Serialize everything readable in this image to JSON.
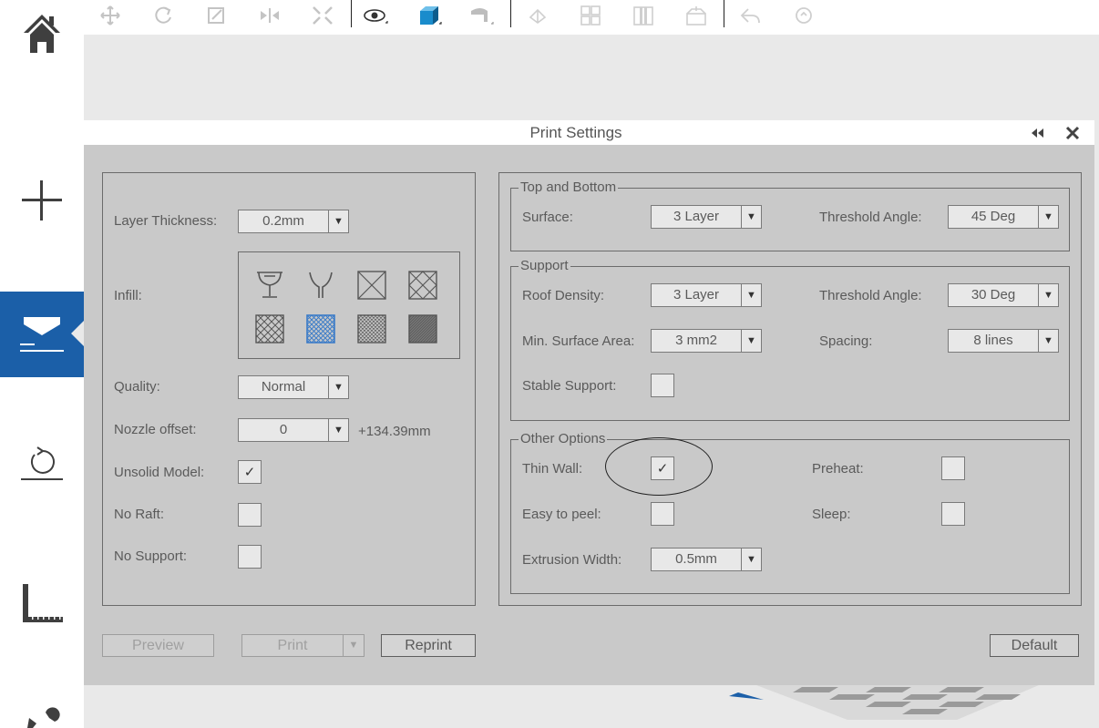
{
  "nav": {
    "items": [
      {
        "name": "home-icon"
      },
      {
        "name": "add-icon"
      },
      {
        "name": "print-settings-icon",
        "active": true
      },
      {
        "name": "rotate-reset-icon"
      },
      {
        "name": "measure-ruler-icon"
      },
      {
        "name": "tools-icon"
      }
    ]
  },
  "toolbar": {
    "tools": [
      "move-icon",
      "rotate-icon",
      "scale-icon",
      "mirror-icon",
      "auto-arrange-icon",
      "view-icon",
      "cube-view-icon",
      "support-icon",
      "repair-icon",
      "layout-grid-icon",
      "split-icon",
      "packaging-icon",
      "undo-icon",
      "redo-icon"
    ]
  },
  "dialog": {
    "title": "Print Settings",
    "left": {
      "layer_thickness": {
        "label": "Layer Thickness:",
        "value": "0.2mm"
      },
      "infill": {
        "label": "Infill:",
        "patterns": [
          "hollow-cup-icon",
          "shell-cup-icon",
          "sparse-cross-icon",
          "diamond-cross-icon",
          "lattice-light-icon",
          "lattice-selected-icon",
          "lattice-medium-icon",
          "solid-icon"
        ],
        "selected_index": 5
      },
      "quality": {
        "label": "Quality:",
        "value": "Normal"
      },
      "nozzle_offset": {
        "label": "Nozzle offset:",
        "value": "0",
        "suffix": "+134.39mm"
      },
      "unsolid_model": {
        "label": "Unsolid Model:",
        "checked": true
      },
      "no_raft": {
        "label": "No Raft:",
        "checked": false
      },
      "no_support": {
        "label": "No Support:",
        "checked": false
      }
    },
    "top_bottom": {
      "legend": "Top and Bottom",
      "surface": {
        "label": "Surface:",
        "value": "3 Layer"
      },
      "threshold": {
        "label": "Threshold Angle:",
        "value": "45 Deg"
      }
    },
    "support": {
      "legend": "Support",
      "roof_density": {
        "label": "Roof Density:",
        "value": "3 Layer"
      },
      "threshold": {
        "label": "Threshold Angle:",
        "value": "30 Deg"
      },
      "min_surface": {
        "label": "Min. Surface Area:",
        "value": "3 mm2"
      },
      "spacing": {
        "label": "Spacing:",
        "value": "8 lines"
      },
      "stable_support": {
        "label": "Stable Support:",
        "checked": false
      }
    },
    "other": {
      "legend": "Other Options",
      "thin_wall": {
        "label": "Thin Wall:",
        "checked": true
      },
      "preheat": {
        "label": "Preheat:",
        "checked": false
      },
      "easy_peel": {
        "label": "Easy to peel:",
        "checked": false
      },
      "sleep": {
        "label": "Sleep:",
        "checked": false
      },
      "extrusion_width": {
        "label": "Extrusion Width:",
        "value": "0.5mm"
      }
    },
    "buttons": {
      "preview": "Preview",
      "print": "Print",
      "reprint": "Reprint",
      "default": "Default"
    },
    "check_mark": "✓",
    "dropdown_arrow": "▼"
  },
  "colors": {
    "accent": "#1b5fa8",
    "selected_infill": "#3a7bc8",
    "dialog_bg": "#c9c9c9"
  }
}
